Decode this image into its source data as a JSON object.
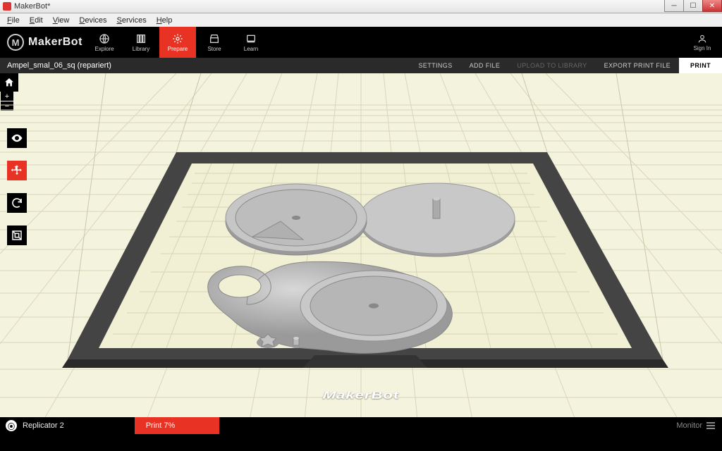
{
  "window": {
    "title": "MakerBot*"
  },
  "menubar": {
    "file": "File",
    "edit": "Edit",
    "view": "View",
    "devices": "Devices",
    "services": "Services",
    "help": "Help"
  },
  "brand": {
    "name": "MakerBot",
    "glyph": "M"
  },
  "nav": {
    "explore": "Explore",
    "library": "Library",
    "prepare": "Prepare",
    "store": "Store",
    "learn": "Learn",
    "signin": "Sign In"
  },
  "subbar": {
    "filename": "Ampel_smal_06_sq (repariert)",
    "settings": "SETTINGS",
    "addfile": "ADD FILE",
    "upload": "UPLOAD TO LIBRARY",
    "export": "EXPORT PRINT FILE",
    "print": "PRINT"
  },
  "plate": {
    "brand": "MakerBot"
  },
  "footer": {
    "printer": "Replicator 2",
    "progress": "Print 7%",
    "monitor": "Monitor"
  },
  "icons": {
    "home": "⌂",
    "plus": "+",
    "minus": "−",
    "eye": "👁",
    "move": "✥",
    "rotate": "⟳",
    "scale": "⛶",
    "signin": "👤"
  }
}
